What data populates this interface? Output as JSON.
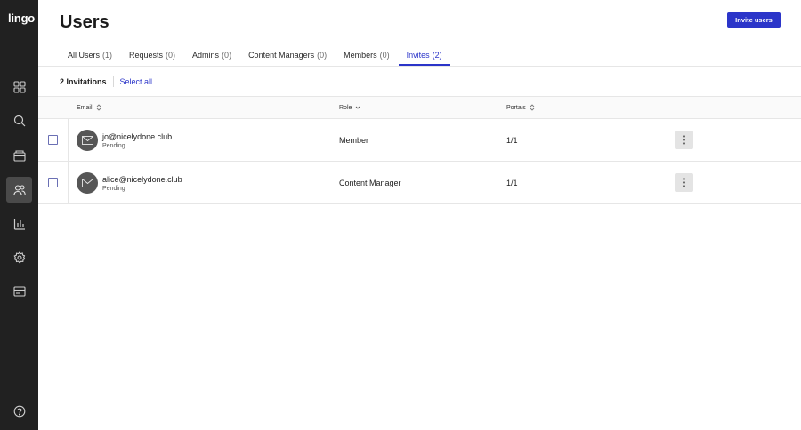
{
  "app": {
    "logo": "lingo"
  },
  "sidebar": {
    "items": [
      {
        "name": "dashboard-icon",
        "active": false
      },
      {
        "name": "search-icon",
        "active": false
      },
      {
        "name": "box-icon",
        "active": false
      },
      {
        "name": "users-icon",
        "active": true
      },
      {
        "name": "chart-icon",
        "active": false
      },
      {
        "name": "gear-icon",
        "active": false
      },
      {
        "name": "billing-icon",
        "active": false
      },
      {
        "name": "help-icon",
        "active": false
      }
    ]
  },
  "header": {
    "title": "Users",
    "invite_label": "Invite users"
  },
  "tabs": [
    {
      "label": "All Users",
      "count": "(1)",
      "active": false
    },
    {
      "label": "Requests",
      "count": "(0)",
      "active": false
    },
    {
      "label": "Admins",
      "count": "(0)",
      "active": false
    },
    {
      "label": "Content Managers",
      "count": "(0)",
      "active": false
    },
    {
      "label": "Members",
      "count": "(0)",
      "active": false
    },
    {
      "label": "Invites",
      "count": "(2)",
      "active": true
    }
  ],
  "toolbar": {
    "count_label": "2 Invitations",
    "select_all": "Select all"
  },
  "table": {
    "columns": {
      "email": "Email",
      "role": "Role",
      "portals": "Portals"
    },
    "rows": [
      {
        "email": "jo@nicelydone.club",
        "status": "Pending",
        "role": "Member",
        "portals": "1/1"
      },
      {
        "email": "alice@nicelydone.club",
        "status": "Pending",
        "role": "Content Manager",
        "portals": "1/1"
      }
    ]
  },
  "colors": {
    "accent": "#2b35c9",
    "sidebar": "#212121",
    "active_nav": "#4a4a4a"
  }
}
